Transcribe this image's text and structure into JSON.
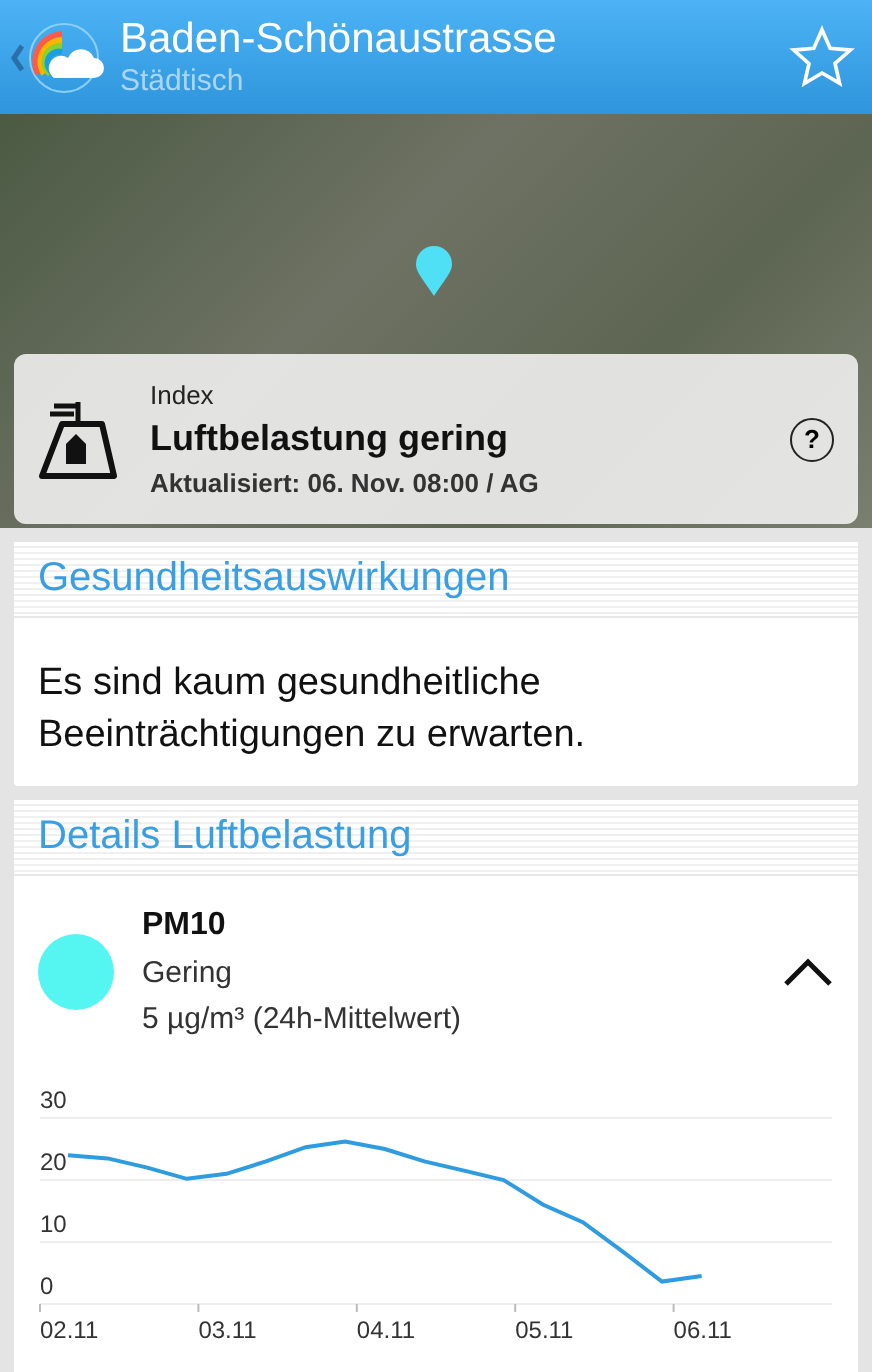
{
  "header": {
    "title": "Baden-Schönaustrasse",
    "subtitle": "Städtisch"
  },
  "index_card": {
    "label": "Index",
    "title": "Luftbelastung gering",
    "updated": "Aktualisiert: 06. Nov. 08:00 / AG",
    "help": "?"
  },
  "health": {
    "heading": "Gesundheitsauswirkungen",
    "text": "Es sind kaum gesundheitliche Beeinträchtigungen zu erwarten."
  },
  "details": {
    "heading": "Details Luftbelastung",
    "pollutant": {
      "name": "PM10",
      "rating": "Gering",
      "value": "5 µg/m³ (24h-Mittelwert)",
      "color": "#55f5f2",
      "expanded": true
    },
    "chart_data": {
      "type": "line",
      "categories": [
        "02.11",
        null,
        null,
        null,
        "03.11",
        null,
        null,
        null,
        "04.11",
        null,
        null,
        null,
        "05.11",
        null,
        null,
        null,
        "06.11",
        null
      ],
      "series": [
        {
          "color": "#2f9be0",
          "values": [
            24,
            23.5,
            22,
            20.2,
            21,
            23,
            25.3,
            26.2,
            25,
            23,
            21.5,
            20,
            16,
            13.2,
            8.5,
            3.6,
            4.5,
            null
          ]
        }
      ],
      "ylim": [
        0,
        30
      ],
      "yticks": [
        0,
        10,
        20,
        30
      ]
    }
  }
}
